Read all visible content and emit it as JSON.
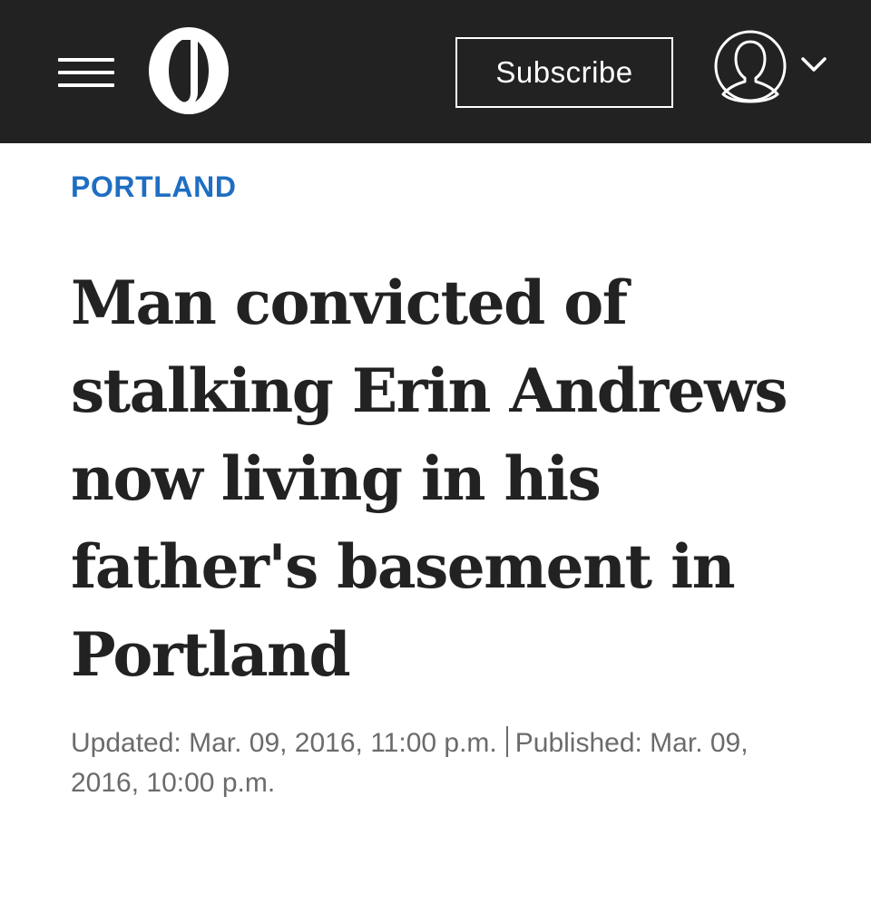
{
  "header": {
    "menu_icon": "hamburger-menu-icon",
    "logo_icon": "oregonian-o-logo",
    "subscribe_label": "Subscribe",
    "account_icon": "user-avatar-icon",
    "account_dropdown_icon": "chevron-down-icon",
    "background_color": "#222222"
  },
  "article": {
    "section": "PORTLAND",
    "section_color": "#1f6ec2",
    "headline_lines": [
      "Man convicted of",
      "stalking Erin Andrews",
      "now living in his",
      "father's basement in",
      "Portland"
    ],
    "updated": "Updated: Mar. 09, 2016, 11:00 p.m.",
    "published_line1": "Published: Mar. 09,",
    "published_line2": "2016, 10:00 p.m."
  }
}
